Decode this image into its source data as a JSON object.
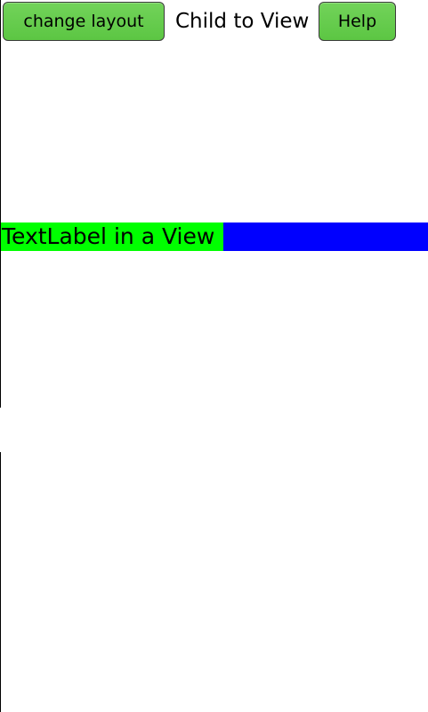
{
  "toolbar": {
    "change_layout_label": "change layout",
    "title": "Child to View",
    "help_label": "Help"
  },
  "view": {
    "label_text": "TextLabel in a View",
    "label_color": "#00ff00",
    "view_color": "#0000ff"
  },
  "colors": {
    "button_green": "#5cc643",
    "background": "#ffffff"
  }
}
